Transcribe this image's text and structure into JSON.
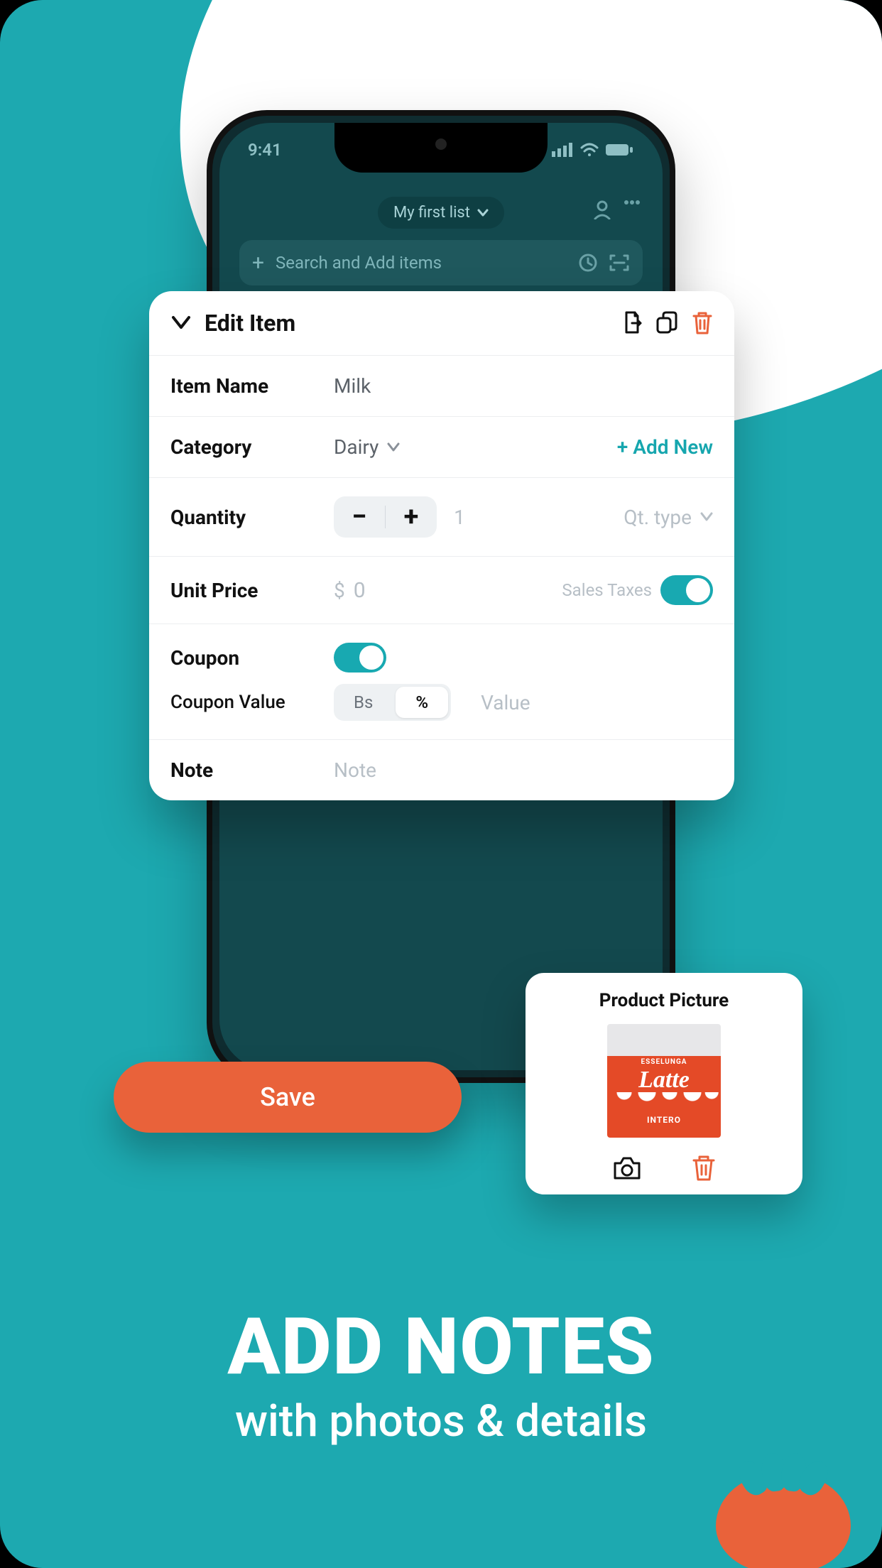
{
  "status": {
    "time": "9:41"
  },
  "phone": {
    "list_name": "My first list",
    "search_placeholder": "Search and Add items"
  },
  "editCard": {
    "title": "Edit Item",
    "itemName": {
      "label": "Item Name",
      "value": "Milk"
    },
    "category": {
      "label": "Category",
      "value": "Dairy",
      "addNew": "+ Add New"
    },
    "quantity": {
      "label": "Quantity",
      "value": "1",
      "typePlaceholder": "Qt. type"
    },
    "unitPrice": {
      "label": "Unit Price",
      "currency": "$",
      "value": "0",
      "salesTaxesLabel": "Sales Taxes"
    },
    "coupon": {
      "label": "Coupon",
      "valueLabel": "Coupon Value",
      "segA": "Bs",
      "segB": "%",
      "valuePlaceholder": "Value"
    },
    "note": {
      "label": "Note",
      "placeholder": "Note"
    }
  },
  "saveBtn": "Save",
  "pictureCard": {
    "title": "Product Picture",
    "brand": "ESSELUNGA",
    "product": "Latte",
    "variant": "INTERO"
  },
  "hero": {
    "title": "ADD NOTES",
    "subtitle": "with photos & details"
  }
}
